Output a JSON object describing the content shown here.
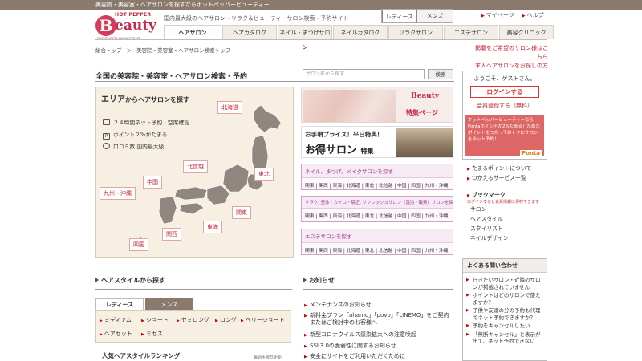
{
  "topbar": {
    "text": "美容院・美容室・ヘアサロンを探すならホットペッパービューティー"
  },
  "logo": {
    "hp": "HOT PEPPER",
    "b": "B",
    "eauty": "eauty",
    "by": "PRODUCED BY RECRUIT"
  },
  "tagline": "国内最大級のヘアサロン・リラク＆ビューティーサロン検索・予約サイト",
  "gender": {
    "ladies": "レディース",
    "mens": "メンズ"
  },
  "toplinks": {
    "mypage": "マイページ",
    "help": "ヘルプ"
  },
  "nav": [
    {
      "label": "ヘアサロン"
    },
    {
      "label": "ヘアカタログ"
    },
    {
      "label": "ネイル・まつげサロン"
    },
    {
      "label": "ネイルカタログ"
    },
    {
      "label": "リラクサロン"
    },
    {
      "label": "エステサロン"
    },
    {
      "label": "美容クリニック"
    }
  ],
  "breadcrumb": {
    "items": [
      "総合トップ",
      "＞",
      "美容院・美容室・ヘアサロン検索トップ"
    ]
  },
  "righttop": {
    "line1": "掲載をご希望のサロン様はこちら",
    "line2": "求人ヘアサロンをお探しの方"
  },
  "page_title": "全国の美容院・美容室・ヘアサロン検索・予約",
  "search": {
    "placeholder": "サロン名から探す",
    "button": "検索"
  },
  "area": {
    "title_bold": "エリア",
    "title_rest": "からヘアサロンを探す",
    "features": [
      "２４時間ネット予約・空席確認",
      "ポイント２%がたまる",
      "口コミ数 国内最大級"
    ],
    "regions": {
      "hokkaido": "北海道",
      "tohoku": "東北",
      "hokushinetsu": "北信越",
      "kanto": "関東",
      "tokai": "東海",
      "kansai": "関西",
      "chugoku": "中国",
      "shikoku": "四国",
      "kyushu": "九州・沖縄"
    }
  },
  "banners": {
    "special_brand": "Beauty",
    "special_page": "特集ページ",
    "deal_line1": "お手頃プライス！平日特典！",
    "deal_big": "お得サロン",
    "deal_small": "特集"
  },
  "categories": [
    {
      "title": "ネイル、まつげ、メイクサロンを探す",
      "regions": "関東 | 関西 | 東海 | 北海道 | 東北 | 北信越 | 中国 | 四国 | 九州・沖縄"
    },
    {
      "title": "リラク, 整体・カイロ・矯正, リフレッシュサロン（温浴・酸素）サロンを探す",
      "regions": "関東 | 関西 | 東海 | 北海道 | 東北 | 北信越 | 中国 | 四国 | 九州・沖縄"
    },
    {
      "title": "エステサロンを探す",
      "regions": "関東 | 関西 | 東海 | 北海道 | 東北 | 北信越 | 中国 | 四国 | 九州・沖縄"
    }
  ],
  "welcome": {
    "greeting": "ようこそ、ゲストさん。",
    "login": "ログインする",
    "register": "会員登録する（無料）",
    "ponta": "ホットペッパービューティーならPontaポイントが2%たまる！ためたポイントをつかっておトクにサロンをネット予約！",
    "ponta_logo": "Ponta"
  },
  "sidelinks": [
    "たまるポイントについて",
    "つかえるサービス一覧"
  ],
  "bookmark": {
    "title": "ブックマーク",
    "sub": "ログインすると会員情報に保存できます",
    "items": [
      "サロン",
      "ヘアスタイル",
      "スタイリスト",
      "ネイルデザイン"
    ]
  },
  "faq": {
    "title": "よくある問い合わせ",
    "items": [
      "行きたいサロン・近隣のサロンが掲載されていません",
      "ポイントはどのサロンで使えますか？",
      "子供や友達の分の予約も代理でネット予約できますか？",
      "予約をキャンセルしたい",
      "「無断キャンセル」と表示が出て、ネット予約できない"
    ]
  },
  "hairstyle": {
    "title": "ヘアスタイルから探す",
    "tabs": [
      "レディース",
      "メンズ"
    ],
    "items": [
      "ミディアム",
      "ショート",
      "セミロング",
      "ロング",
      "ベリーショート",
      "ヘアセット",
      "ミセス"
    ],
    "ranking": "人気ヘアスタイルランキング",
    "ranking_date": "毎週木曜日更新"
  },
  "news": {
    "title": "お知らせ",
    "items": [
      "メンテナンスのお知らせ",
      "新料金プラン「ahamo」「povo」「LINEMO」をご契約またはご検討中のお客様へ",
      "新型コロナウイルス感染拡大への注意喚起",
      "SSL3.0の脆弱性に関するお知らせ",
      "安全にサイトをご利用いただくために"
    ]
  }
}
